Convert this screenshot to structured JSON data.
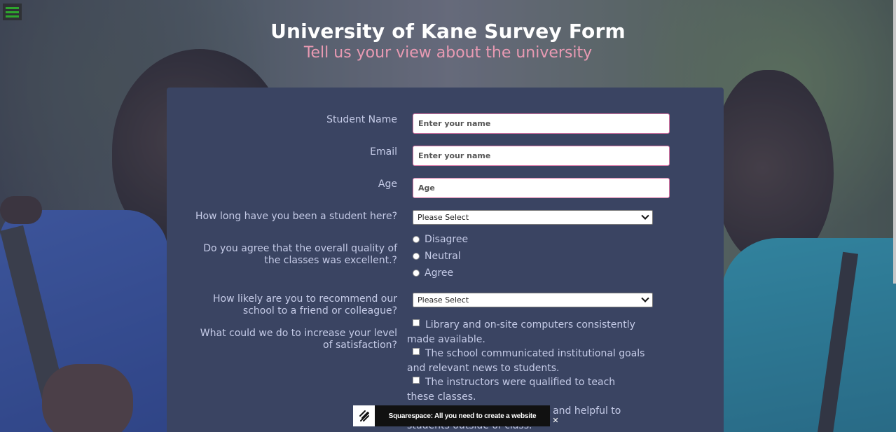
{
  "header": {
    "title": "University of Kane Survey Form",
    "subtitle": "Tell us your view about the university"
  },
  "form": {
    "name_label": "Student Name",
    "name_placeholder": "Enter your name",
    "email_label": "Email",
    "email_placeholder": "Enter your name",
    "age_label": "Age",
    "age_placeholder": "Age",
    "duration_label": "How long have you been a student here?",
    "duration_selected": "Please Select",
    "quality_label": "Do you agree that the overall quality of the classes was excellent.?",
    "quality_options": [
      "Disagree",
      "Neutral",
      "Agree"
    ],
    "recommend_label": "How likely are you to recommend our school to a friend or colleague?",
    "recommend_selected": "Please Select",
    "improve_label": "What could we do to increase your level of satisfaction?",
    "improve_options": [
      "Library and on-site computers consistently made available.",
      "The school communicated institutional goals and relevant news to students.",
      "The instructors were qualified to teach these classes.",
      "The faculty was available and helpful to students outside of class."
    ]
  },
  "ad": {
    "text": "Squarespace: All you need to create a website",
    "close_glyph": "✕"
  },
  "colors": {
    "panel": "#3a4462",
    "accent_pink": "#e99ab3",
    "menu_green": "#2ea52e"
  },
  "icons": {
    "menu": "hamburger-menu-icon",
    "ad_logo": "squarespace-logo-icon",
    "close": "close-icon"
  }
}
